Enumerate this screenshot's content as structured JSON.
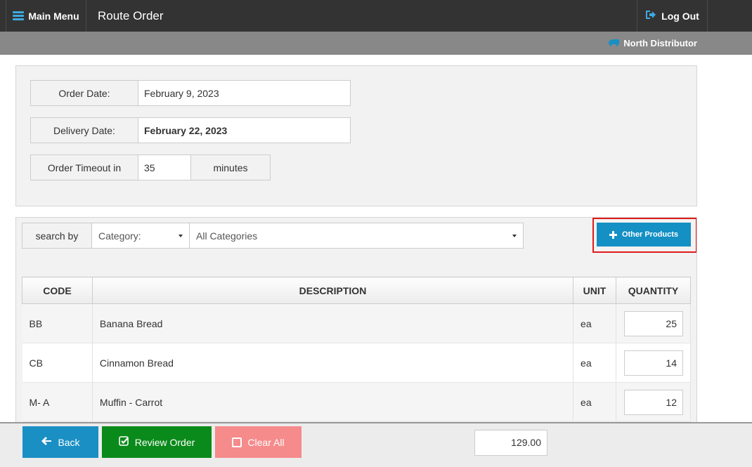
{
  "header": {
    "menu_label": "Main Menu",
    "title": "Route Order",
    "logout_label": "Log Out"
  },
  "subheader": {
    "distributor": "North Distributor"
  },
  "order": {
    "order_date_label": "Order Date:",
    "order_date": "February 9, 2023",
    "delivery_date_label": "Delivery Date:",
    "delivery_date": "February 22, 2023",
    "timeout_label": "Order Timeout in",
    "timeout_value": "35",
    "timeout_unit": "minutes"
  },
  "search": {
    "label": "search by",
    "field_selected": "Category:",
    "category_selected": "All Categories",
    "other_products_label": "Other Products"
  },
  "table": {
    "columns": [
      "CODE",
      "DESCRIPTION",
      "UNIT",
      "QUANTITY"
    ],
    "rows": [
      {
        "code": "BB",
        "description": "Banana Bread",
        "unit": "ea",
        "quantity": "25"
      },
      {
        "code": "CB",
        "description": "Cinnamon Bread",
        "unit": "ea",
        "quantity": "14"
      },
      {
        "code": "M- A",
        "description": "Muffin - Carrot",
        "unit": "ea",
        "quantity": "12"
      }
    ]
  },
  "footer": {
    "back_label": "Back",
    "review_label": "Review Order",
    "clear_label": "Clear All",
    "total": "129.00"
  },
  "colors": {
    "topbar": "#333333",
    "subbar": "#888888",
    "primary_blue": "#1490c4",
    "review_green": "#0a8a1a",
    "clear_pink": "#f58b8b",
    "highlight_red": "#e01b1b"
  },
  "icons": {
    "menu": "hamburger-icon",
    "logout": "sign-out-icon",
    "distributor": "truck-icon",
    "other_products": "plus-icon",
    "back": "arrow-left-icon",
    "review": "check-square-icon",
    "clear": "square-icon"
  }
}
